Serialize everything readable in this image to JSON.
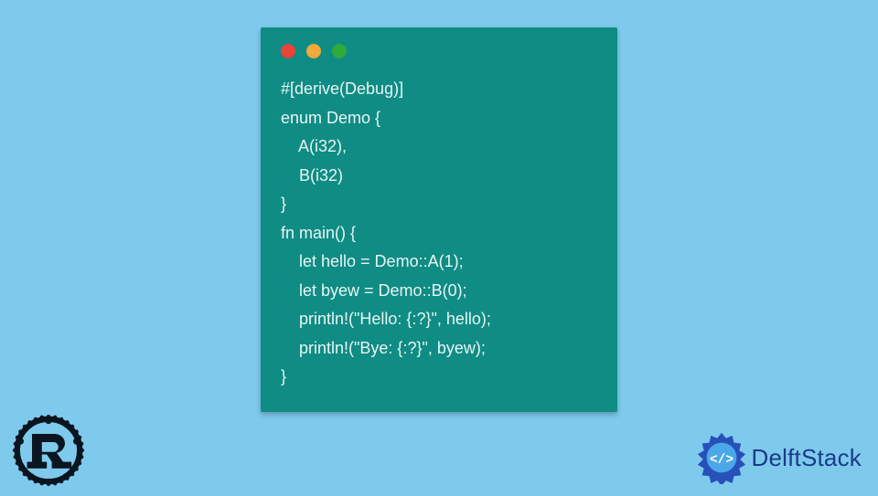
{
  "code": {
    "lines": [
      "#[derive(Debug)]",
      "enum Demo {",
      "    A(i32),",
      "    B(i32)",
      "}",
      "fn main() {",
      "    let hello = Demo::A(1);",
      "    let byew = Demo::B(0);",
      "    println!(\"Hello: {:?}\", hello);",
      "    println!(\"Bye: {:?}\", byew);",
      "}"
    ]
  },
  "window": {
    "dots": [
      "red",
      "yellow",
      "green"
    ]
  },
  "branding": {
    "delft_text": "DelftStack"
  }
}
